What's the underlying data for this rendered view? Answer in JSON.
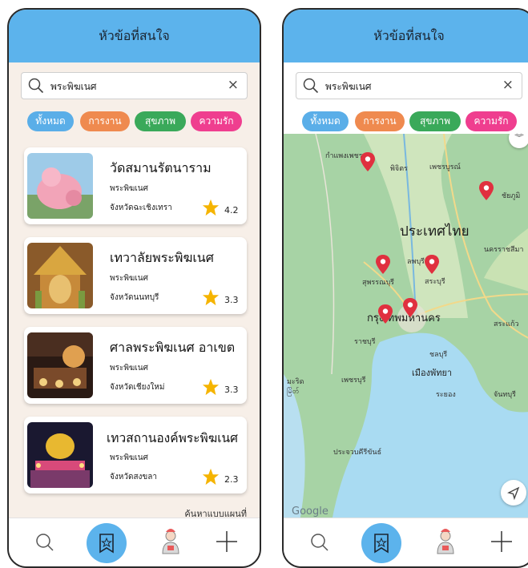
{
  "left_screen": {
    "header_title": "หัวข้อที่สนใจ",
    "search": {
      "value": "พระพิฆเนศ",
      "clear_symbol": "×"
    },
    "chips": [
      "ทั้งหมด",
      "การงาน",
      "สุขภาพ",
      "ความรัก"
    ],
    "results": [
      {
        "name": "วัดสมานรัตนาราม",
        "deity": "พระพิฆเนศ",
        "province": "จังหวัดฉะเชิงเทรา",
        "rating": "4.2",
        "thumb_color": "#d98aa6"
      },
      {
        "name": "เทวาลัยพระพิฆเนศ",
        "deity": "พระพิฆเนศ",
        "province": "จังหวัดนนทบุรี",
        "rating": "3.3",
        "thumb_color": "#c79a3e"
      },
      {
        "name": "ศาลพระพิฆเนศ อาเขต",
        "deity": "พระพิฆเนศ",
        "province": "จังหวัดเชียงใหม่",
        "rating": "3.3",
        "thumb_color": "#5a3a28"
      },
      {
        "name": "เทวสถานองค์พระพิฆเนศ",
        "deity": "พระพิฆเนศ",
        "province": "จังหวัดสงขลา",
        "rating": "2.3",
        "thumb_color": "#2c2a3a"
      }
    ],
    "map_search_link": "ค้นหาแบบแผนที่"
  },
  "right_screen": {
    "header_title": "หัวข้อที่สนใจ",
    "search": {
      "value": "พระพิฆเนศ",
      "clear_symbol": "×"
    },
    "chips": [
      "ทั้งหมด",
      "การงาน",
      "สุขภาพ",
      "ความรัก"
    ],
    "map_labels": {
      "country": "ประเทศไทย",
      "bangkok": "กรุงเทพมหานคร",
      "kamphaeng_phet": "กำแพงเพชร",
      "phichit": "พิจิตร",
      "phetchabun": "เพชรบูรณ์",
      "chaiyaphum": "ชัยภูมิ",
      "suphan_buri": "สุพรรณบุรี",
      "lopburi": "ลพบุรี",
      "saraburi": "สระบุรี",
      "nakhon_ratchasima": "นครราชสีมา",
      "ratchaburi": "ราชบุรี",
      "sa_kaeo": "สระแก้ว",
      "chonburi": "ชลบุรี",
      "pattaya": "เมืองพัทยา",
      "phetchaburi": "เพชรบุรี",
      "rayong": "ระยอง",
      "chanthaburi": "จันทบุรี",
      "prachuap": "ประจวบคีรีขันธ์",
      "myeik": "มะริด",
      "myeik_burmese": "မြိတ်",
      "google": "Google"
    }
  },
  "nav_icons": [
    "search-icon",
    "bookmark-icon",
    "profile-icon",
    "plus-icon"
  ],
  "colors": {
    "header": "#5cb3ec",
    "chip_all": "#5aaee8",
    "chip_work": "#ef8a4f",
    "chip_health": "#3aa95a",
    "chip_love": "#ef3e8f",
    "star": "#f5b400",
    "pin": "#e0303f"
  }
}
